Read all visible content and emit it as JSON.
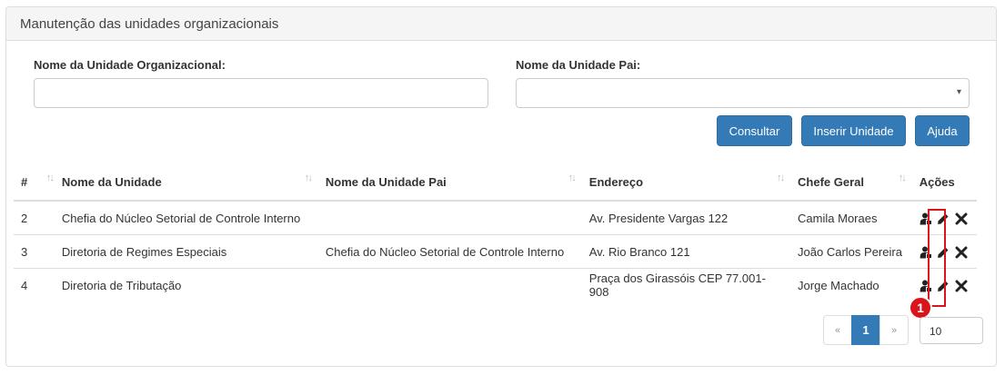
{
  "panel": {
    "title": "Manutenção das unidades organizacionais"
  },
  "form": {
    "unit_name_label": "Nome da Unidade Organizacional:",
    "unit_name_value": "",
    "parent_unit_label": "Nome da Unidade Pai:",
    "parent_unit_value": "",
    "dropdown_icon": "▾"
  },
  "buttons": {
    "search": "Consultar",
    "insert": "Inserir Unidade",
    "help": "Ajuda"
  },
  "table": {
    "columns": [
      "#",
      "Nome da Unidade",
      "Nome da Unidade Pai",
      "Endereço",
      "Chefe Geral",
      "Ações"
    ],
    "sort_icon": "↑↓",
    "rows": [
      {
        "id": "2",
        "name": "Chefia do Núcleo Setorial de Controle Interno",
        "parent": "",
        "address": "Av. Presidente Vargas 122",
        "chief": "Camila Moraes"
      },
      {
        "id": "3",
        "name": "Diretoria de Regimes Especiais",
        "parent": "Chefia do Núcleo Setorial de Controle Interno",
        "address": "Av. Rio Branco 121",
        "chief": "João Carlos Pereira"
      },
      {
        "id": "4",
        "name": "Diretoria de Tributação",
        "parent": "",
        "address": "Praça dos Girassóis CEP 77.001-908",
        "chief": "Jorge Machado"
      }
    ],
    "action_icons": [
      "user-manage-icon",
      "pencil-icon",
      "delete-icon"
    ]
  },
  "annotation": {
    "badge": "1"
  },
  "pagination": {
    "prev": "«",
    "current": "1",
    "next": "»",
    "page_size": "10"
  },
  "colors": {
    "primary": "#337ab7",
    "annotation": "#d9141b"
  }
}
